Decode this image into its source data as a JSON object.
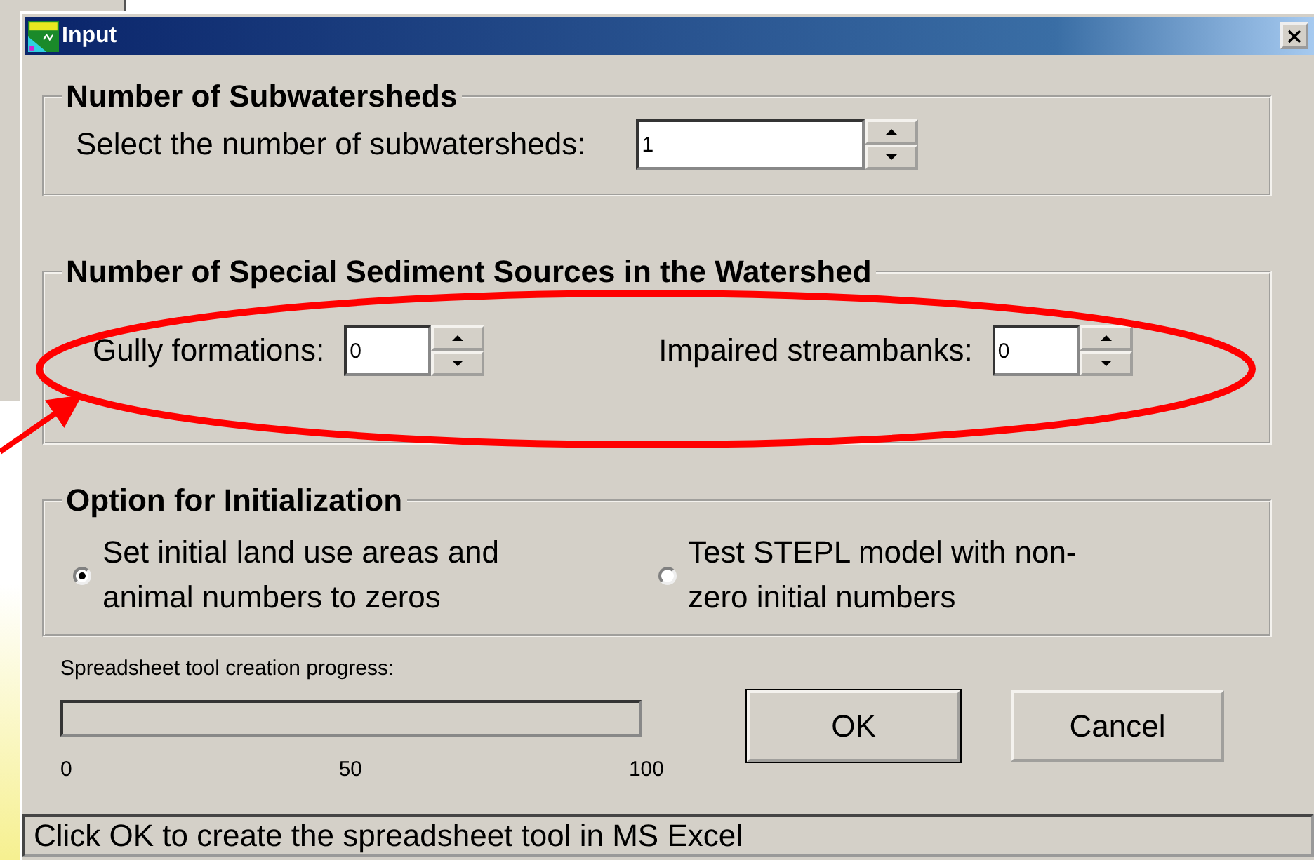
{
  "window": {
    "title": "Input"
  },
  "subwatersheds": {
    "title": "Number of Subwatersheds",
    "label": "Select the number of subwatersheds:",
    "value": "1"
  },
  "sediment_sources": {
    "title": "Number of Special Sediment Sources in the Watershed",
    "fields": [
      {
        "label": "Gully formations:",
        "value": "0"
      },
      {
        "label": "Impaired streambanks:",
        "value": "0"
      }
    ]
  },
  "initialization": {
    "title": "Option for Initialization",
    "options": [
      {
        "label": "Set initial land use areas and animal numbers to zeros",
        "selected": true
      },
      {
        "label": "Test STEPL model with non-zero initial numbers",
        "selected": false
      }
    ]
  },
  "progress": {
    "label": "Spreadsheet tool creation progress:",
    "level": 0,
    "ticks": [
      "0",
      "50",
      "100"
    ]
  },
  "buttons": [
    "OK",
    "Cancel"
  ],
  "status_bar": "Click OK to create the spreadsheet tool in MS Excel"
}
